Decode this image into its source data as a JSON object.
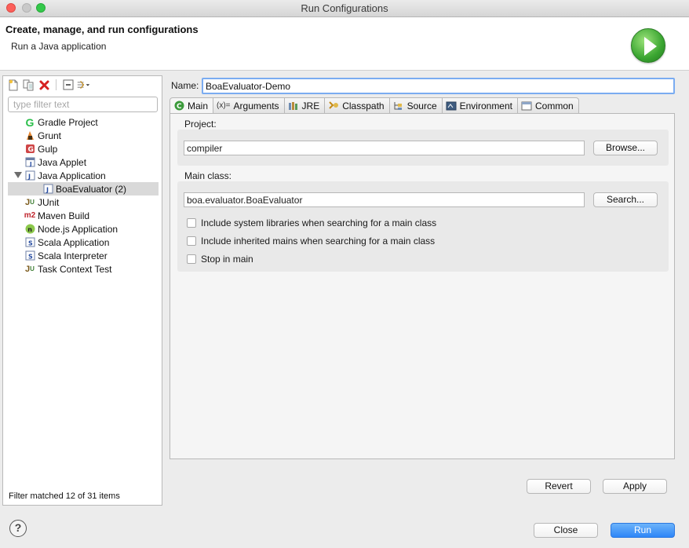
{
  "window": {
    "title": "Run Configurations"
  },
  "header": {
    "title": "Create, manage, and run configurations",
    "description": "Run a Java application",
    "icon": "run-icon"
  },
  "left_toolbar": {
    "icons": [
      "new-launch-config-icon",
      "duplicate-icon",
      "delete-icon",
      "collapse-all-icon",
      "filter-icon"
    ]
  },
  "filter": {
    "placeholder": "type filter text",
    "value": ""
  },
  "tree": {
    "items": [
      {
        "label": "Gradle Project",
        "icon": "gradle-icon"
      },
      {
        "label": "Grunt",
        "icon": "grunt-icon"
      },
      {
        "label": "Gulp",
        "icon": "gulp-icon"
      },
      {
        "label": "Java Applet",
        "icon": "java-applet-icon"
      },
      {
        "label": "Java Application",
        "icon": "java-application-icon",
        "expanded": true
      },
      {
        "label": "BoaEvaluator (2)",
        "icon": "java-config-icon",
        "selected": true,
        "child": true
      },
      {
        "label": "JUnit",
        "icon": "junit-icon"
      },
      {
        "label": "Maven Build",
        "icon": "maven-icon"
      },
      {
        "label": "Node.js Application",
        "icon": "nodejs-icon"
      },
      {
        "label": "Scala Application",
        "icon": "scala-icon"
      },
      {
        "label": "Scala Interpreter",
        "icon": "scala-icon"
      },
      {
        "label": "Task Context Test",
        "icon": "task-context-icon"
      }
    ]
  },
  "filter_status": "Filter matched 12 of 31 items",
  "name": {
    "label": "Name:",
    "value": "BoaEvaluator-Demo"
  },
  "tabs": [
    {
      "label": "Main",
      "icon": "main-tab-icon",
      "glyph": "C",
      "active": true
    },
    {
      "label": "Arguments",
      "icon": "arguments-icon",
      "glyph": "(x)="
    },
    {
      "label": "JRE",
      "icon": "jre-icon",
      "glyph": "▤"
    },
    {
      "label": "Classpath",
      "icon": "classpath-icon",
      "glyph": "◈"
    },
    {
      "label": "Source",
      "icon": "source-icon",
      "glyph": "⇆"
    },
    {
      "label": "Environment",
      "icon": "environment-icon",
      "glyph": "▣"
    },
    {
      "label": "Common",
      "icon": "common-icon",
      "glyph": "▭"
    }
  ],
  "main": {
    "project_label": "Project:",
    "project_value": "compiler",
    "browse_label": "Browse...",
    "main_class_label": "Main class:",
    "main_class_value": "boa.evaluator.BoaEvaluator",
    "search_label": "Search...",
    "checkboxes": [
      {
        "label": "Include system libraries when searching for a main class",
        "checked": false
      },
      {
        "label": "Include inherited mains when searching for a main class",
        "checked": false
      },
      {
        "label": "Stop in main",
        "checked": false
      }
    ]
  },
  "buttons": {
    "revert": "Revert",
    "apply": "Apply",
    "close": "Close",
    "run": "Run",
    "help": "?"
  }
}
